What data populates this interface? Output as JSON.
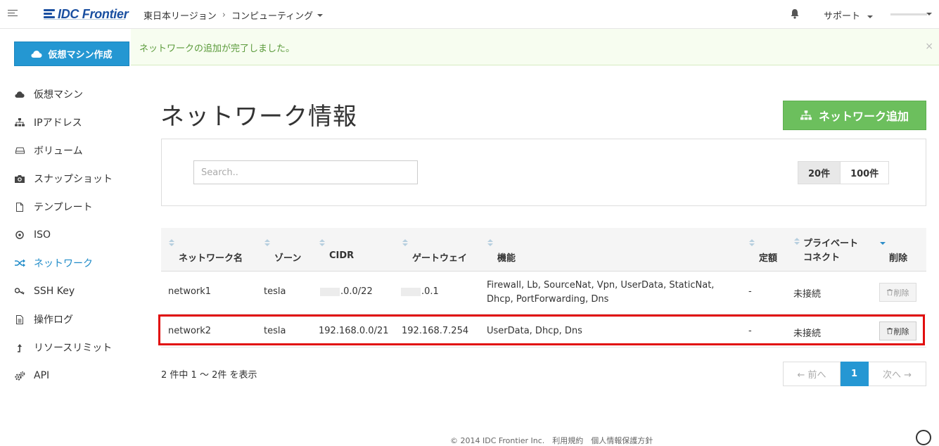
{
  "header": {
    "logo_text": "IDC Frontier",
    "breadcrumb": {
      "region": "東日本リージョン",
      "service": "コンピューティング"
    },
    "support_label": "サポート"
  },
  "actions": {
    "create_vm_label": "仮想マシン作成",
    "add_network_label": "ネットワーク追加"
  },
  "alert": {
    "message": "ネットワークの追加が完了しました。",
    "close": "×"
  },
  "sidebar": {
    "items": [
      {
        "label": "仮想マシン",
        "icon": "cloud-icon"
      },
      {
        "label": "IPアドレス",
        "icon": "sitemap-icon"
      },
      {
        "label": "ボリューム",
        "icon": "hdd-icon"
      },
      {
        "label": "スナップショット",
        "icon": "camera-icon"
      },
      {
        "label": "テンプレート",
        "icon": "file-icon"
      },
      {
        "label": "ISO",
        "icon": "disc-icon"
      },
      {
        "label": "ネットワーク",
        "icon": "shuffle-icon",
        "active": true
      },
      {
        "label": "SSH Key",
        "icon": "key-icon"
      },
      {
        "label": "操作ログ",
        "icon": "document-icon"
      },
      {
        "label": "リソースリミット",
        "icon": "level-up-icon"
      },
      {
        "label": "API",
        "icon": "gears-icon"
      }
    ]
  },
  "main": {
    "title": "ネットワーク情報",
    "search": {
      "placeholder": "Search.."
    },
    "page_sizes": [
      "20件",
      "100件"
    ],
    "table": {
      "headers": {
        "name": "ネットワーク名",
        "zone": "ゾーン",
        "cidr": "CIDR",
        "gateway": "ゲートウェイ",
        "features": "機能",
        "flat_rate": "定額",
        "private_connect_1": "プライベート",
        "private_connect_2": "コネクト",
        "delete": "削除"
      },
      "rows": [
        {
          "name": "network1",
          "zone": "tesla",
          "cidr": ".0.0/22",
          "gateway": ".0.1",
          "features_1": "Firewall, Lb, SourceNat, Vpn, UserData, StaticNat,",
          "features_2": "Dhcp, PortForwarding, Dns",
          "flat_rate": "-",
          "private_connect": "未接続",
          "delete_label": "削除"
        },
        {
          "name": "network2",
          "zone": "tesla",
          "cidr": "192.168.0.0/21",
          "gateway": "192.168.7.254",
          "features_1": "UserData, Dhcp, Dns",
          "flat_rate": "-",
          "private_connect": "未接続",
          "delete_label": "削除"
        }
      ]
    },
    "summary": "2 件中 1 〜 2件 を表示",
    "pagination": {
      "prev": "← 前へ",
      "current": "1",
      "next": "次へ →"
    }
  },
  "footer": {
    "text": "© 2014 IDC Frontier Inc.　利用規約　個人情報保護方針"
  },
  "colors": {
    "primary": "#2497d2",
    "success": "#6cbf5d",
    "highlight": "#e10e0e",
    "active_nav": "#1f8bc8"
  }
}
